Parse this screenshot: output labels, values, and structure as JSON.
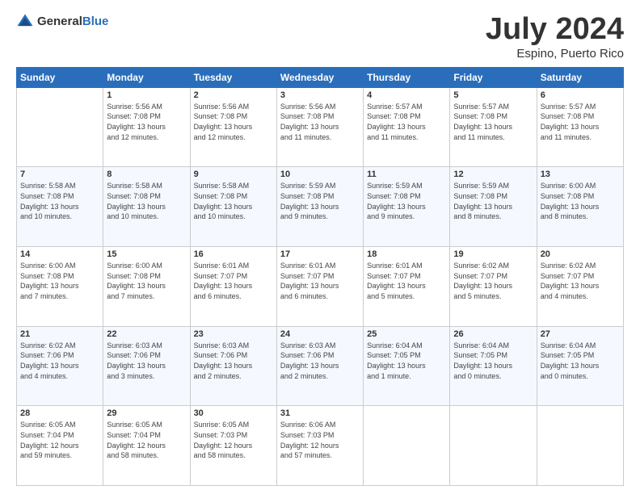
{
  "header": {
    "logo_general": "General",
    "logo_blue": "Blue",
    "title": "July 2024",
    "location": "Espino, Puerto Rico"
  },
  "days_of_week": [
    "Sunday",
    "Monday",
    "Tuesday",
    "Wednesday",
    "Thursday",
    "Friday",
    "Saturday"
  ],
  "weeks": [
    [
      {
        "day": "",
        "info": ""
      },
      {
        "day": "1",
        "info": "Sunrise: 5:56 AM\nSunset: 7:08 PM\nDaylight: 13 hours\nand 12 minutes."
      },
      {
        "day": "2",
        "info": "Sunrise: 5:56 AM\nSunset: 7:08 PM\nDaylight: 13 hours\nand 12 minutes."
      },
      {
        "day": "3",
        "info": "Sunrise: 5:56 AM\nSunset: 7:08 PM\nDaylight: 13 hours\nand 11 minutes."
      },
      {
        "day": "4",
        "info": "Sunrise: 5:57 AM\nSunset: 7:08 PM\nDaylight: 13 hours\nand 11 minutes."
      },
      {
        "day": "5",
        "info": "Sunrise: 5:57 AM\nSunset: 7:08 PM\nDaylight: 13 hours\nand 11 minutes."
      },
      {
        "day": "6",
        "info": "Sunrise: 5:57 AM\nSunset: 7:08 PM\nDaylight: 13 hours\nand 11 minutes."
      }
    ],
    [
      {
        "day": "7",
        "info": "Sunrise: 5:58 AM\nSunset: 7:08 PM\nDaylight: 13 hours\nand 10 minutes."
      },
      {
        "day": "8",
        "info": "Sunrise: 5:58 AM\nSunset: 7:08 PM\nDaylight: 13 hours\nand 10 minutes."
      },
      {
        "day": "9",
        "info": "Sunrise: 5:58 AM\nSunset: 7:08 PM\nDaylight: 13 hours\nand 10 minutes."
      },
      {
        "day": "10",
        "info": "Sunrise: 5:59 AM\nSunset: 7:08 PM\nDaylight: 13 hours\nand 9 minutes."
      },
      {
        "day": "11",
        "info": "Sunrise: 5:59 AM\nSunset: 7:08 PM\nDaylight: 13 hours\nand 9 minutes."
      },
      {
        "day": "12",
        "info": "Sunrise: 5:59 AM\nSunset: 7:08 PM\nDaylight: 13 hours\nand 8 minutes."
      },
      {
        "day": "13",
        "info": "Sunrise: 6:00 AM\nSunset: 7:08 PM\nDaylight: 13 hours\nand 8 minutes."
      }
    ],
    [
      {
        "day": "14",
        "info": "Sunrise: 6:00 AM\nSunset: 7:08 PM\nDaylight: 13 hours\nand 7 minutes."
      },
      {
        "day": "15",
        "info": "Sunrise: 6:00 AM\nSunset: 7:08 PM\nDaylight: 13 hours\nand 7 minutes."
      },
      {
        "day": "16",
        "info": "Sunrise: 6:01 AM\nSunset: 7:07 PM\nDaylight: 13 hours\nand 6 minutes."
      },
      {
        "day": "17",
        "info": "Sunrise: 6:01 AM\nSunset: 7:07 PM\nDaylight: 13 hours\nand 6 minutes."
      },
      {
        "day": "18",
        "info": "Sunrise: 6:01 AM\nSunset: 7:07 PM\nDaylight: 13 hours\nand 5 minutes."
      },
      {
        "day": "19",
        "info": "Sunrise: 6:02 AM\nSunset: 7:07 PM\nDaylight: 13 hours\nand 5 minutes."
      },
      {
        "day": "20",
        "info": "Sunrise: 6:02 AM\nSunset: 7:07 PM\nDaylight: 13 hours\nand 4 minutes."
      }
    ],
    [
      {
        "day": "21",
        "info": "Sunrise: 6:02 AM\nSunset: 7:06 PM\nDaylight: 13 hours\nand 4 minutes."
      },
      {
        "day": "22",
        "info": "Sunrise: 6:03 AM\nSunset: 7:06 PM\nDaylight: 13 hours\nand 3 minutes."
      },
      {
        "day": "23",
        "info": "Sunrise: 6:03 AM\nSunset: 7:06 PM\nDaylight: 13 hours\nand 2 minutes."
      },
      {
        "day": "24",
        "info": "Sunrise: 6:03 AM\nSunset: 7:06 PM\nDaylight: 13 hours\nand 2 minutes."
      },
      {
        "day": "25",
        "info": "Sunrise: 6:04 AM\nSunset: 7:05 PM\nDaylight: 13 hours\nand 1 minute."
      },
      {
        "day": "26",
        "info": "Sunrise: 6:04 AM\nSunset: 7:05 PM\nDaylight: 13 hours\nand 0 minutes."
      },
      {
        "day": "27",
        "info": "Sunrise: 6:04 AM\nSunset: 7:05 PM\nDaylight: 13 hours\nand 0 minutes."
      }
    ],
    [
      {
        "day": "28",
        "info": "Sunrise: 6:05 AM\nSunset: 7:04 PM\nDaylight: 12 hours\nand 59 minutes."
      },
      {
        "day": "29",
        "info": "Sunrise: 6:05 AM\nSunset: 7:04 PM\nDaylight: 12 hours\nand 58 minutes."
      },
      {
        "day": "30",
        "info": "Sunrise: 6:05 AM\nSunset: 7:03 PM\nDaylight: 12 hours\nand 58 minutes."
      },
      {
        "day": "31",
        "info": "Sunrise: 6:06 AM\nSunset: 7:03 PM\nDaylight: 12 hours\nand 57 minutes."
      },
      {
        "day": "",
        "info": ""
      },
      {
        "day": "",
        "info": ""
      },
      {
        "day": "",
        "info": ""
      }
    ]
  ]
}
